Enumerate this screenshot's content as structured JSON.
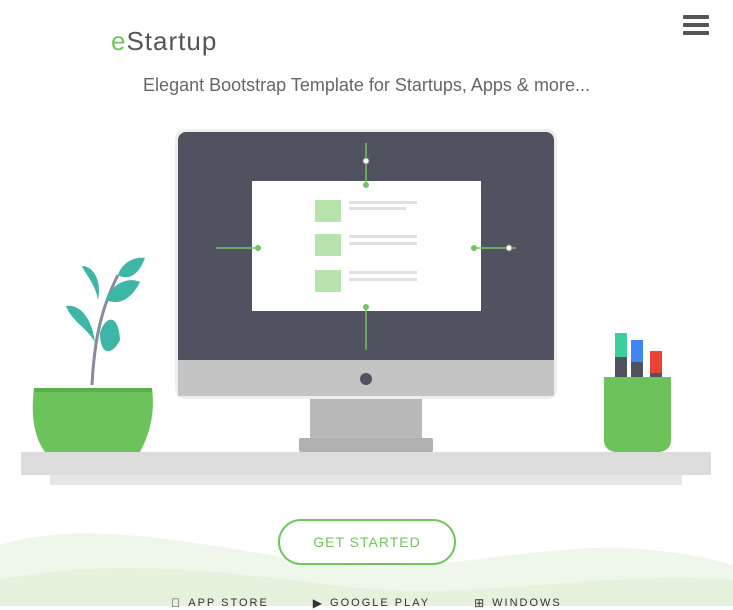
{
  "header": {
    "logo_accent": "e",
    "logo_rest": "Startup",
    "menu_icon": "hamburger-icon"
  },
  "hero": {
    "tagline": "Elegant Bootstrap Template for Startups, Apps & more...",
    "cta_label": "GET STARTED"
  },
  "stores": [
    {
      "label": "APP STORE",
      "icon": "apple-icon"
    },
    {
      "label": "GOOGLE PLAY",
      "icon": "play-icon"
    },
    {
      "label": "WINDOWS",
      "icon": "windows-icon"
    }
  ],
  "colors": {
    "accent": "#71c55d",
    "monitor": "#50525f",
    "teal": "#3db6a6"
  }
}
